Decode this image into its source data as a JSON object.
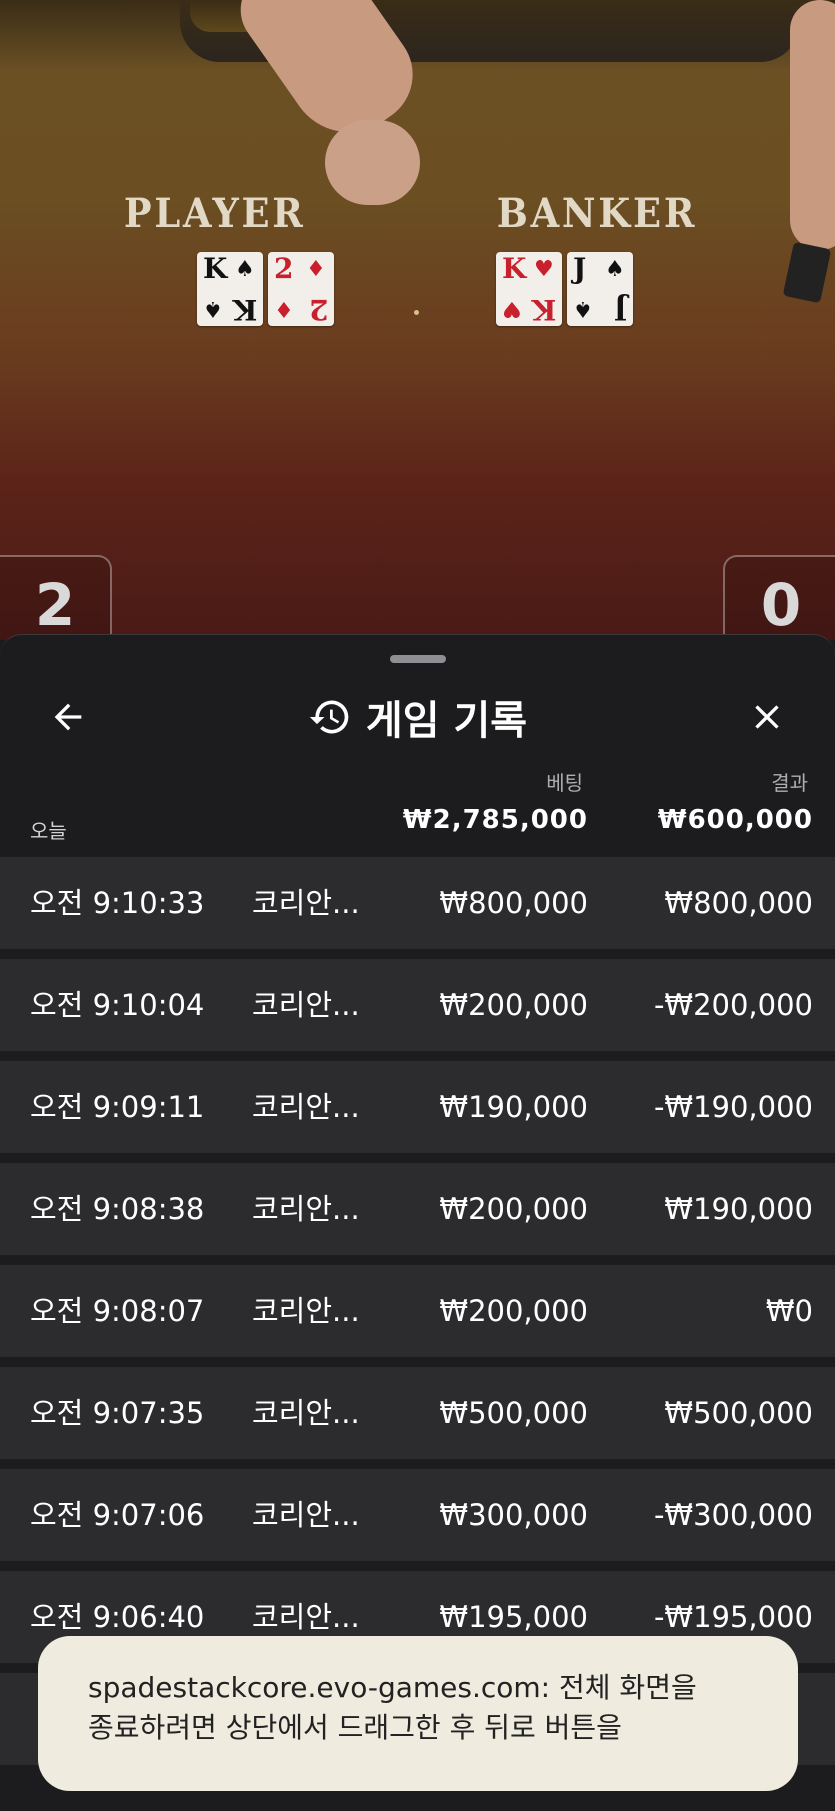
{
  "table": {
    "player_label": "PLAYER",
    "banker_label": "BANKER",
    "player_cards": [
      {
        "rank": "K",
        "suit": "♠",
        "color": "black"
      },
      {
        "rank": "2",
        "suit": "♦",
        "color": "red"
      }
    ],
    "banker_cards": [
      {
        "rank": "K",
        "suit": "♥",
        "color": "red"
      },
      {
        "rank": "J",
        "suit": "♠",
        "color": "black"
      }
    ],
    "player_score": "2",
    "banker_score": "0"
  },
  "sheet": {
    "title": "게임 기록",
    "back_icon": "back-arrow-icon",
    "history_icon": "history-icon",
    "close_icon": "close-icon",
    "bet_header": "베팅",
    "result_header": "결과",
    "today_label": "오늘",
    "total_bet": "₩2,785,000",
    "total_result": "₩600,000",
    "rows": [
      {
        "time": "오전 9:10:33",
        "game": "코리안...",
        "bet": "₩800,000",
        "result": "₩800,000"
      },
      {
        "time": "오전 9:10:04",
        "game": "코리안...",
        "bet": "₩200,000",
        "result": "-₩200,000"
      },
      {
        "time": "오전 9:09:11",
        "game": "코리안...",
        "bet": "₩190,000",
        "result": "-₩190,000"
      },
      {
        "time": "오전 9:08:38",
        "game": "코리안...",
        "bet": "₩200,000",
        "result": "₩190,000"
      },
      {
        "time": "오전 9:08:07",
        "game": "코리안...",
        "bet": "₩200,000",
        "result": "₩0"
      },
      {
        "time": "오전 9:07:35",
        "game": "코리안...",
        "bet": "₩500,000",
        "result": "₩500,000"
      },
      {
        "time": "오전 9:07:06",
        "game": "코리안...",
        "bet": "₩300,000",
        "result": "-₩300,000"
      },
      {
        "time": "오전 9:06:40",
        "game": "코리안...",
        "bet": "₩195,000",
        "result": "-₩195,000"
      }
    ]
  },
  "toast": {
    "line1": "spadestackcore.evo-games.com: 전체 화면을",
    "line2": "종료하려면 상단에서 드래그한 후 뒤로 버튼을"
  }
}
